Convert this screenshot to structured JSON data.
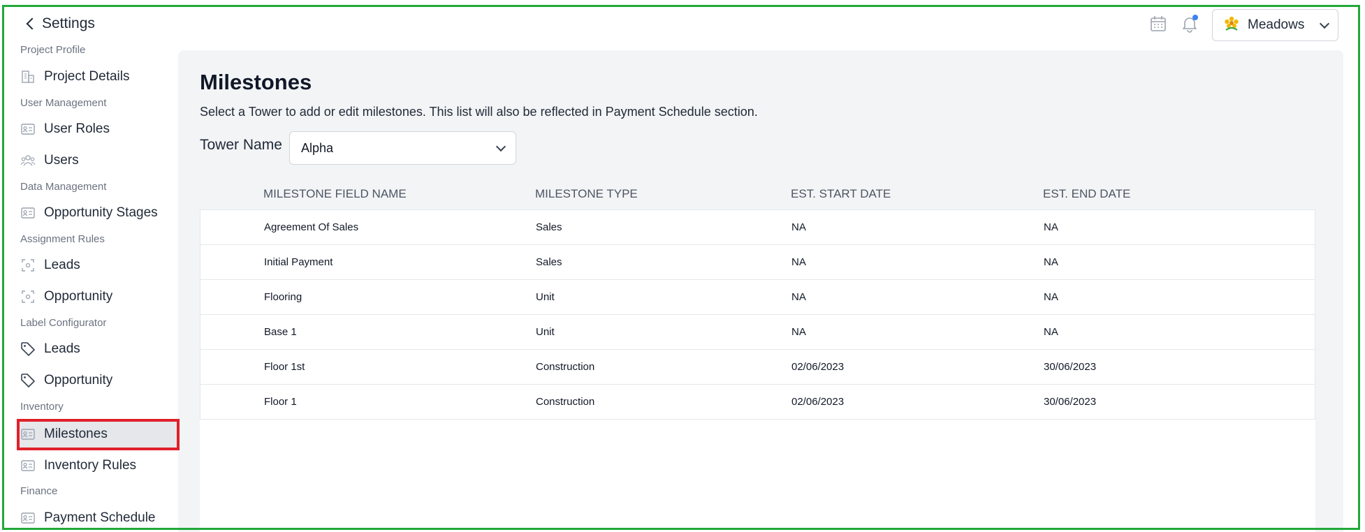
{
  "header": {
    "back_label": "Settings",
    "user_name": "Meadows",
    "accent_color": "#22a83a",
    "notification_dot_color": "#3b82f6"
  },
  "sidebar": {
    "sections": [
      {
        "title": "Project Profile",
        "items": [
          {
            "label": "Project Details",
            "icon": "building-icon"
          }
        ]
      },
      {
        "title": "User Management",
        "items": [
          {
            "label": "User Roles",
            "icon": "id-card-icon"
          },
          {
            "label": "Users",
            "icon": "users-icon"
          }
        ]
      },
      {
        "title": "Data Management",
        "items": [
          {
            "label": "Opportunity Stages",
            "icon": "id-card-icon"
          }
        ]
      },
      {
        "title": "Assignment Rules",
        "items": [
          {
            "label": "Leads",
            "icon": "focus-icon"
          },
          {
            "label": "Opportunity",
            "icon": "focus-icon"
          }
        ]
      },
      {
        "title": "Label Configurator",
        "items": [
          {
            "label": "Leads",
            "icon": "tag-icon"
          },
          {
            "label": "Opportunity",
            "icon": "tag-icon"
          }
        ]
      },
      {
        "title": "Inventory",
        "items": [
          {
            "label": "Milestones",
            "icon": "id-card-icon",
            "active": true
          },
          {
            "label": "Inventory Rules",
            "icon": "id-card-icon"
          }
        ]
      },
      {
        "title": "Finance",
        "items": [
          {
            "label": "Payment Schedule",
            "icon": "id-card-icon"
          }
        ]
      }
    ]
  },
  "main": {
    "title": "Milestones",
    "description": "Select a Tower to add or edit milestones. This list will also be reflected in Payment Schedule section.",
    "tower_label": "Tower Name",
    "tower_value": "Alpha",
    "table": {
      "headers": [
        "MILESTONE FIELD NAME",
        "MILESTONE TYPE",
        "EST. START DATE",
        "EST. END DATE"
      ],
      "rows": [
        [
          "Agreement Of Sales",
          "Sales",
          "NA",
          "NA"
        ],
        [
          "Initial Payment",
          "Sales",
          "NA",
          "NA"
        ],
        [
          "Flooring",
          "Unit",
          "NA",
          "NA"
        ],
        [
          "Base 1",
          "Unit",
          "NA",
          "NA"
        ],
        [
          "Floor 1st",
          "Construction",
          "02/06/2023",
          "30/06/2023"
        ],
        [
          "Floor 1",
          "Construction",
          "02/06/2023",
          "30/06/2023"
        ]
      ]
    }
  }
}
